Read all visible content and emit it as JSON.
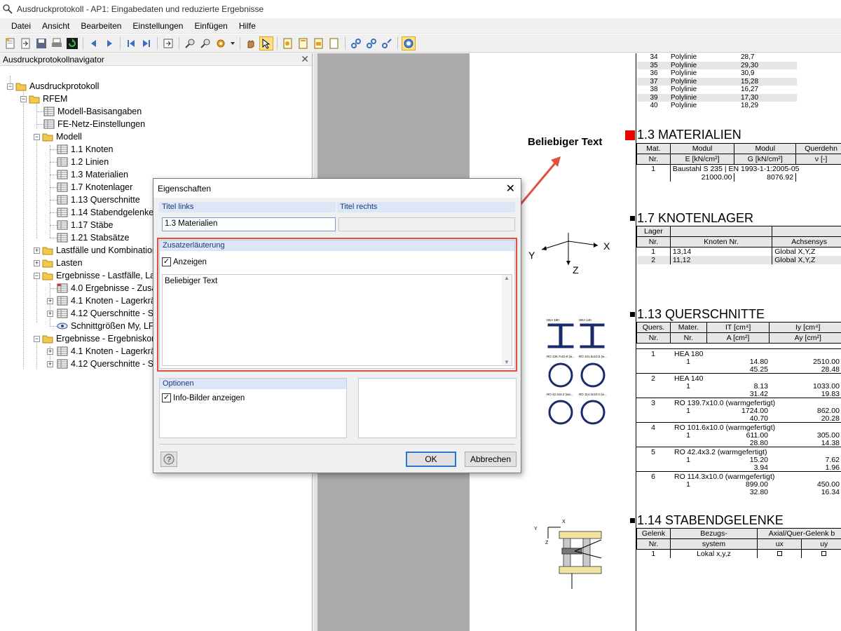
{
  "window": {
    "title": "Ausdruckprotokoll - AP1: Eingabedaten und reduzierte Ergebnisse"
  },
  "menu": [
    "Datei",
    "Ansicht",
    "Bearbeiten",
    "Einstellungen",
    "Einfügen",
    "Hilfe"
  ],
  "navigator": {
    "title": "Ausdruckprotokollnavigator",
    "items": [
      "Ausdruckprotokoll",
      "RFEM",
      "Modell-Basisangaben",
      "FE-Netz-Einstellungen",
      "Modell",
      "1.1 Knoten",
      "1.2 Linien",
      "1.3 Materialien",
      "1.7 Knotenlager",
      "1.13 Querschnitte",
      "1.14 Stabendgelenke",
      "1.17 Stäbe",
      "1.21 Stabsätze",
      "Lastfälle und Kombination",
      "Lasten",
      "Ergebnisse - Lastfälle, Last",
      "4.0 Ergebnisse - Zusam",
      "4.1 Knoten - Lagerkräft",
      "4.12 Querschnitte - Sch",
      "Schnittgrößen My, LF1",
      "Ergebnisse - Ergebniskomb",
      "4.1 Knoten - Lagerkräft",
      "4.12 Querschnitte - Sch"
    ]
  },
  "dialog": {
    "title": "Eigenschaften",
    "titel_links_label": "Titel links",
    "titel_rechts_label": "Titel rechts",
    "titel_links_value": "1.3 Materialien",
    "titel_rechts_value": "",
    "zusatz_label": "Zusatzerläuterung",
    "anzeigen_label": "Anzeigen",
    "anzeigen_checked": true,
    "zusatz_text": "Beliebiger Text",
    "optionen_label": "Optionen",
    "info_bilder_label": "Info-Bilder anzeigen",
    "info_bilder_checked": true,
    "ok_label": "OK",
    "cancel_label": "Abbrechen"
  },
  "annotation": {
    "text": "Beliebiger Text"
  },
  "report": {
    "line_rows": [
      [
        "34",
        "Polylinie",
        "28,7"
      ],
      [
        "35",
        "Polylinie",
        "29,30"
      ],
      [
        "36",
        "Polylinie",
        "30,9"
      ],
      [
        "37",
        "Polylinie",
        "15,28"
      ],
      [
        "38",
        "Polylinie",
        "16,27"
      ],
      [
        "39",
        "Polylinie",
        "17,30"
      ],
      [
        "40",
        "Polylinie",
        "18,29"
      ]
    ],
    "materialien": {
      "heading": "1.3 MATERIALIEN",
      "h1": [
        "Mat.",
        "Modul",
        "Modul",
        "Querdehn"
      ],
      "h2": [
        "Nr.",
        "E [kN/cm²]",
        "G [kN/cm²]",
        "ν [-]"
      ],
      "row_nr": "1",
      "row_name": "Baustahl S 235 | EN 1993-1-1:2005-05",
      "row_e": "21000.00",
      "row_g": "8076.92"
    },
    "knotenlager": {
      "heading": "1.7 KNOTENLAGER",
      "h1": [
        "Lager",
        "",
        ""
      ],
      "h2": [
        "Nr.",
        "Knoten Nr.",
        "Achsensys"
      ],
      "rows": [
        [
          "1",
          "13,14",
          "Global X,Y,Z"
        ],
        [
          "2",
          "11,12",
          "Global X,Y,Z"
        ]
      ]
    },
    "querschnitte": {
      "heading": "1.13 QUERSCHNITTE",
      "h1": [
        "Quers.",
        "Mater.",
        "IT [cm⁴]",
        "Iy [cm⁴]"
      ],
      "h2": [
        "Nr.",
        "Nr.",
        "A [cm²]",
        "Ay [cm²]"
      ],
      "rows": [
        {
          "nr": "1",
          "name": "HEA 180",
          "mat": "1",
          "v1": "14.80",
          "v2": "45.25",
          "w1": "2510.00",
          "w2": "28.48"
        },
        {
          "nr": "2",
          "name": "HEA 140",
          "mat": "1",
          "v1": "8.13",
          "v2": "31.42",
          "w1": "1033.00",
          "w2": "19.83"
        },
        {
          "nr": "3",
          "name": "RO 139.7x10.0 (warmgefertigt)",
          "mat": "1",
          "v1": "1724.00",
          "v2": "40.70",
          "w1": "862.00",
          "w2": "20.28"
        },
        {
          "nr": "4",
          "name": "RO 101.6x10.0 (warmgefertigt)",
          "mat": "1",
          "v1": "611.00",
          "v2": "28.80",
          "w1": "305.00",
          "w2": "14.38"
        },
        {
          "nr": "5",
          "name": "RO 42.4x3.2 (warmgefertigt)",
          "mat": "1",
          "v1": "15.20",
          "v2": "3.94",
          "w1": "7.62",
          "w2": "1.96"
        },
        {
          "nr": "6",
          "name": "RO 114.3x10.0 (warmgefertigt)",
          "mat": "1",
          "v1": "899.00",
          "v2": "32.80",
          "w1": "450.00",
          "w2": "16.34"
        }
      ]
    },
    "stabendgelenke": {
      "heading": "1.14 STABENDGELENKE",
      "h1": [
        "Gelenk",
        "Bezugs-",
        "Axial/Quer-Gelenk b"
      ],
      "h2": [
        "Nr.",
        "system",
        "ux",
        "uy"
      ],
      "row": [
        "1",
        "Lokal x,y,z"
      ]
    },
    "axes": {
      "x": "X",
      "y": "Y",
      "z": "Z"
    },
    "thumb_labels": [
      "HEA 180",
      "HEA 140",
      "RO 139.7x10.0 (w...",
      "RO 101.6x10.0 (w...",
      "RO 42.4x3.2 (wa...",
      "RO 114.3x10.0 (w..."
    ]
  },
  "colors": {
    "accent_red": "#e05040",
    "marker_red": "#ee0000",
    "group_header": "#dde6f7"
  }
}
